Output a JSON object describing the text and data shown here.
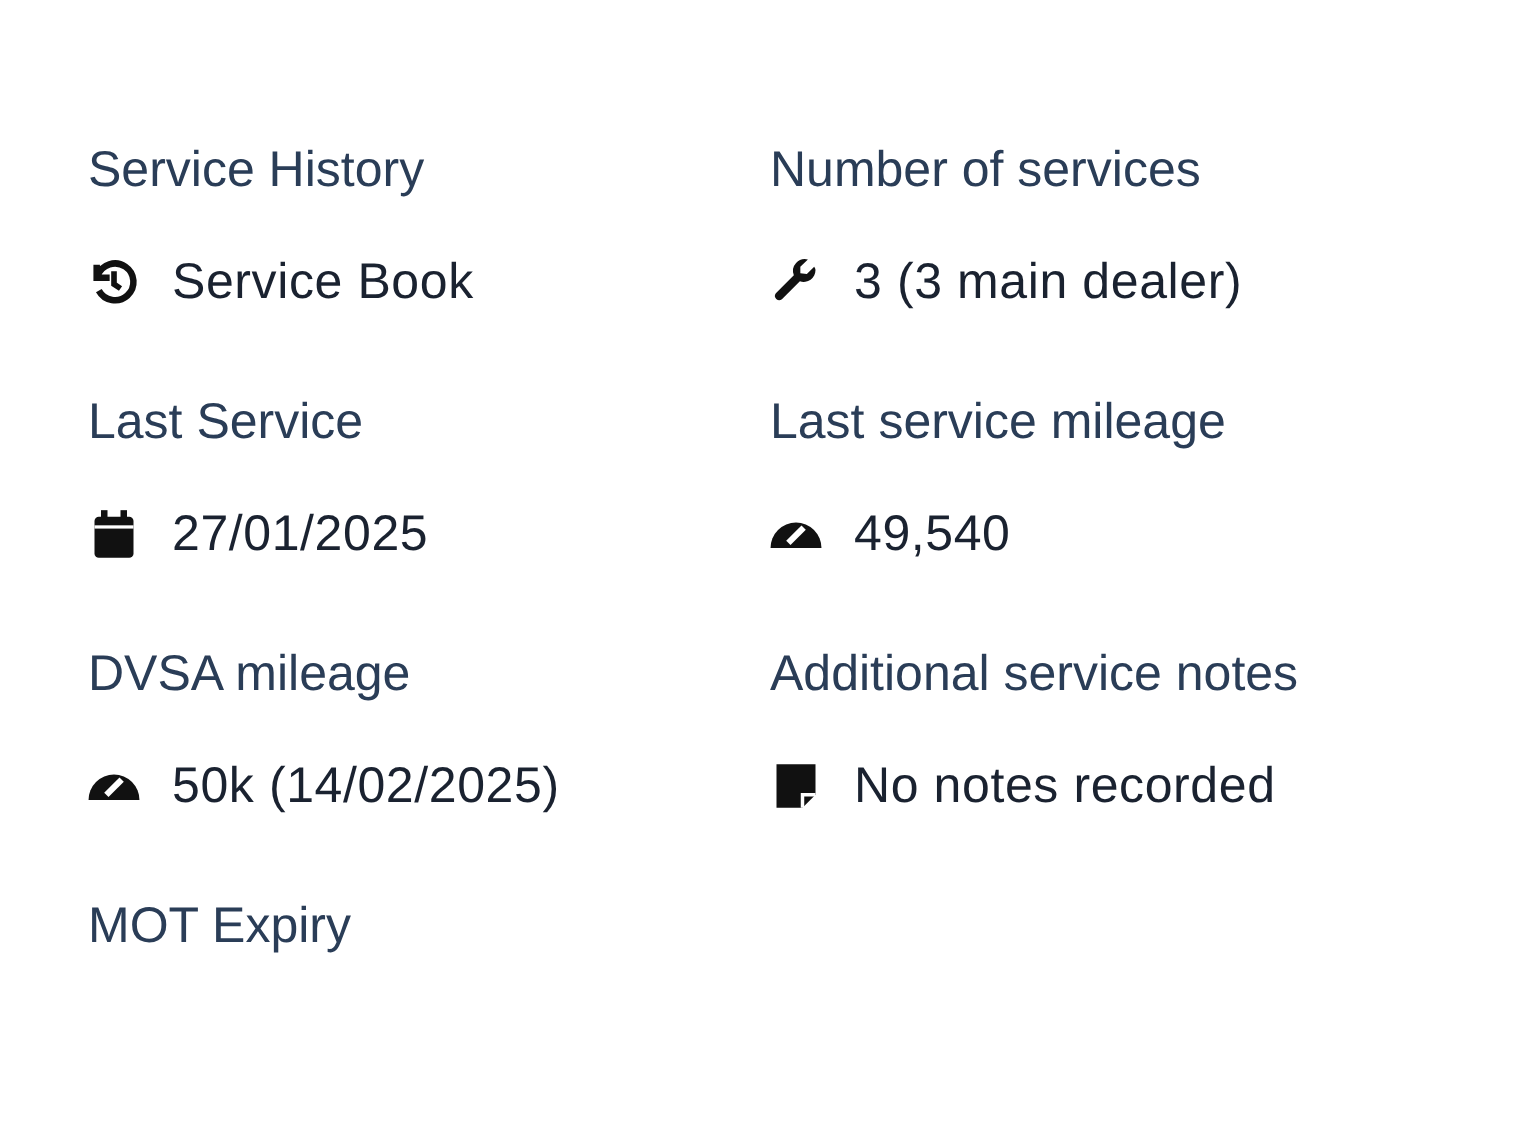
{
  "fields": [
    {
      "label": "Service History",
      "value": "Service Book",
      "kind": "history"
    },
    {
      "label": "Number of services",
      "value": "3 (3 main dealer)",
      "kind": "wrench"
    },
    {
      "label": "Last Service",
      "value": "27/01/2025",
      "kind": "calendar"
    },
    {
      "label": "Last service mileage",
      "value": "49,540",
      "kind": "gauge"
    },
    {
      "label": "DVSA mileage",
      "value": "50k (14/02/2025)",
      "kind": "gauge"
    },
    {
      "label": "Additional service notes",
      "value": "No notes recorded",
      "kind": "note"
    },
    {
      "label": "MOT Expiry"
    }
  ]
}
